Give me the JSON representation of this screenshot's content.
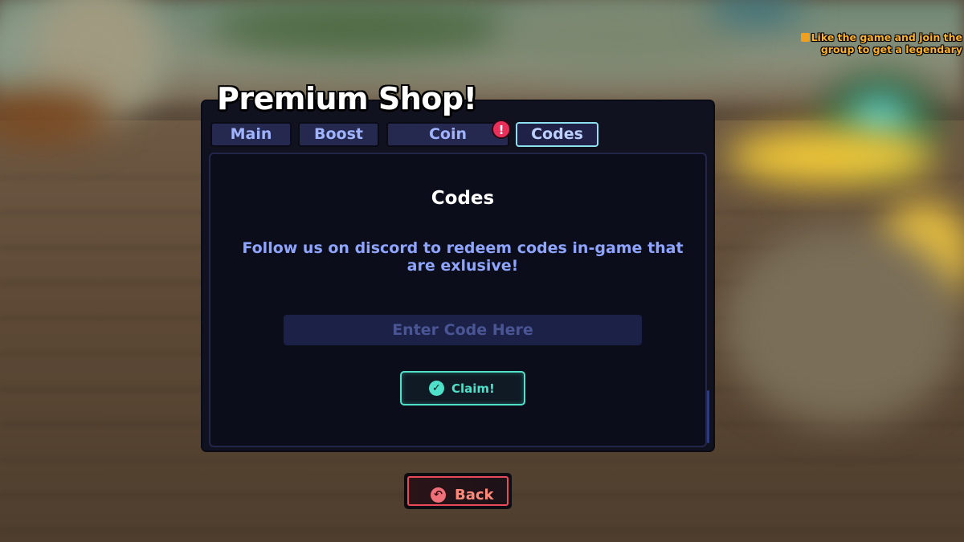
{
  "panel": {
    "title": "Premium Shop!"
  },
  "promo": {
    "line1": "Like the game and join the",
    "line2": "group to get a legendary"
  },
  "tabs": [
    {
      "label": "Main",
      "active": false
    },
    {
      "label": "Boost",
      "active": false
    },
    {
      "label": "Coin",
      "active": false,
      "alert": "!"
    },
    {
      "label": "Codes",
      "active": true
    }
  ],
  "codes": {
    "heading": "Codes",
    "description": "Follow us on discord to redeem codes in-game that are exlusive!",
    "input_placeholder": "Enter Code Here",
    "input_value": "",
    "claim_label": "Claim!"
  },
  "back_label": "Back",
  "icons": {
    "alert": "exclamation-icon",
    "claim": "check-icon",
    "back": "back-arrow-icon",
    "promo": "thumbs-up-icon"
  },
  "colors": {
    "accent_cyan": "#4ee0c8",
    "tab_text": "#9fb3ff",
    "back_red": "#e84a5a",
    "promo_orange": "#ffb22e"
  }
}
